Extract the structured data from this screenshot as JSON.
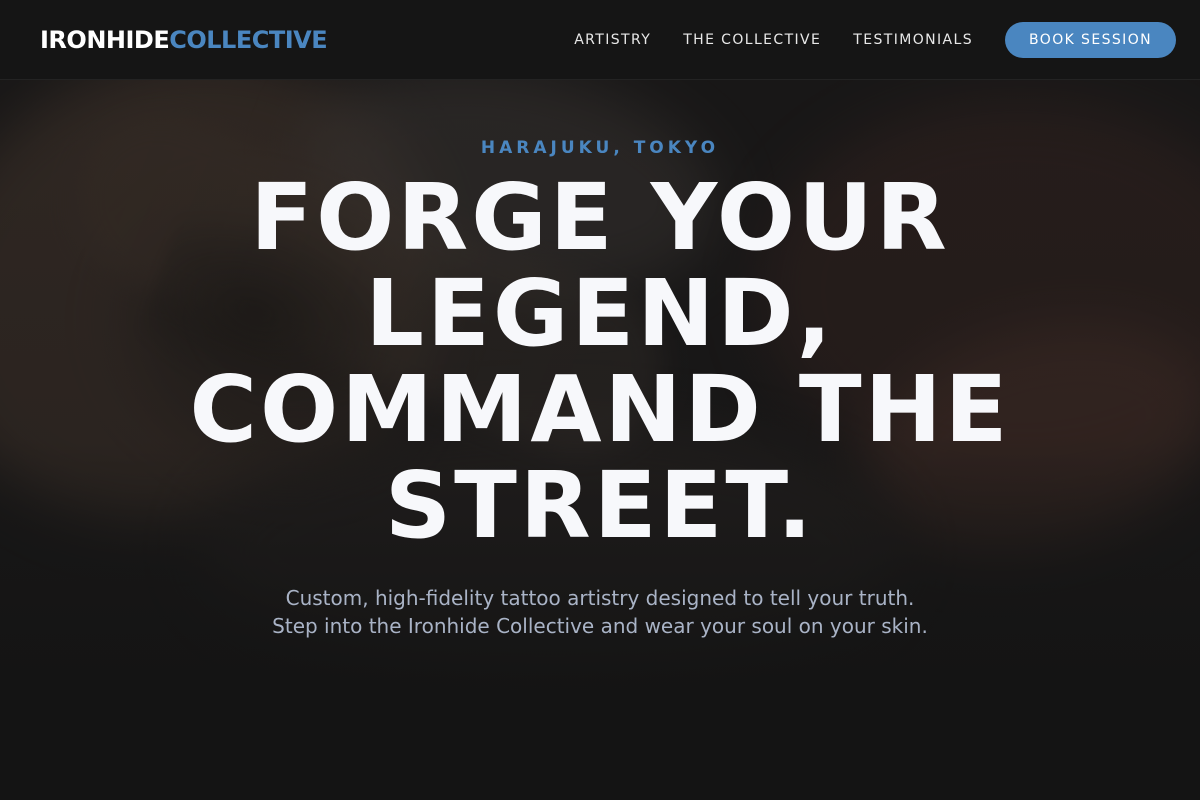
{
  "nav": {
    "logo_part1": "IRONHIDE",
    "logo_part2": "COLLECTIVE",
    "links": [
      "ARTISTRY",
      "THE COLLECTIVE",
      "TESTIMONIALS"
    ],
    "cta_label": "BOOK SESSION"
  },
  "hero": {
    "eyebrow": "HARAJUKU, TOKYO",
    "headline_lines": [
      "FORGE YOUR",
      "LEGEND,",
      "COMMAND THE",
      "STREET."
    ],
    "subline_lines": [
      "Custom, high-fidelity tattoo artistry designed to tell your truth.",
      "Step into the Ironhide Collective and wear your soul on your skin."
    ]
  },
  "colors": {
    "accent": "#4a86c0",
    "background": "#141414",
    "nav_background": "#151515",
    "headline": "#f7f8fb",
    "subtext": "#a9b3c6"
  }
}
